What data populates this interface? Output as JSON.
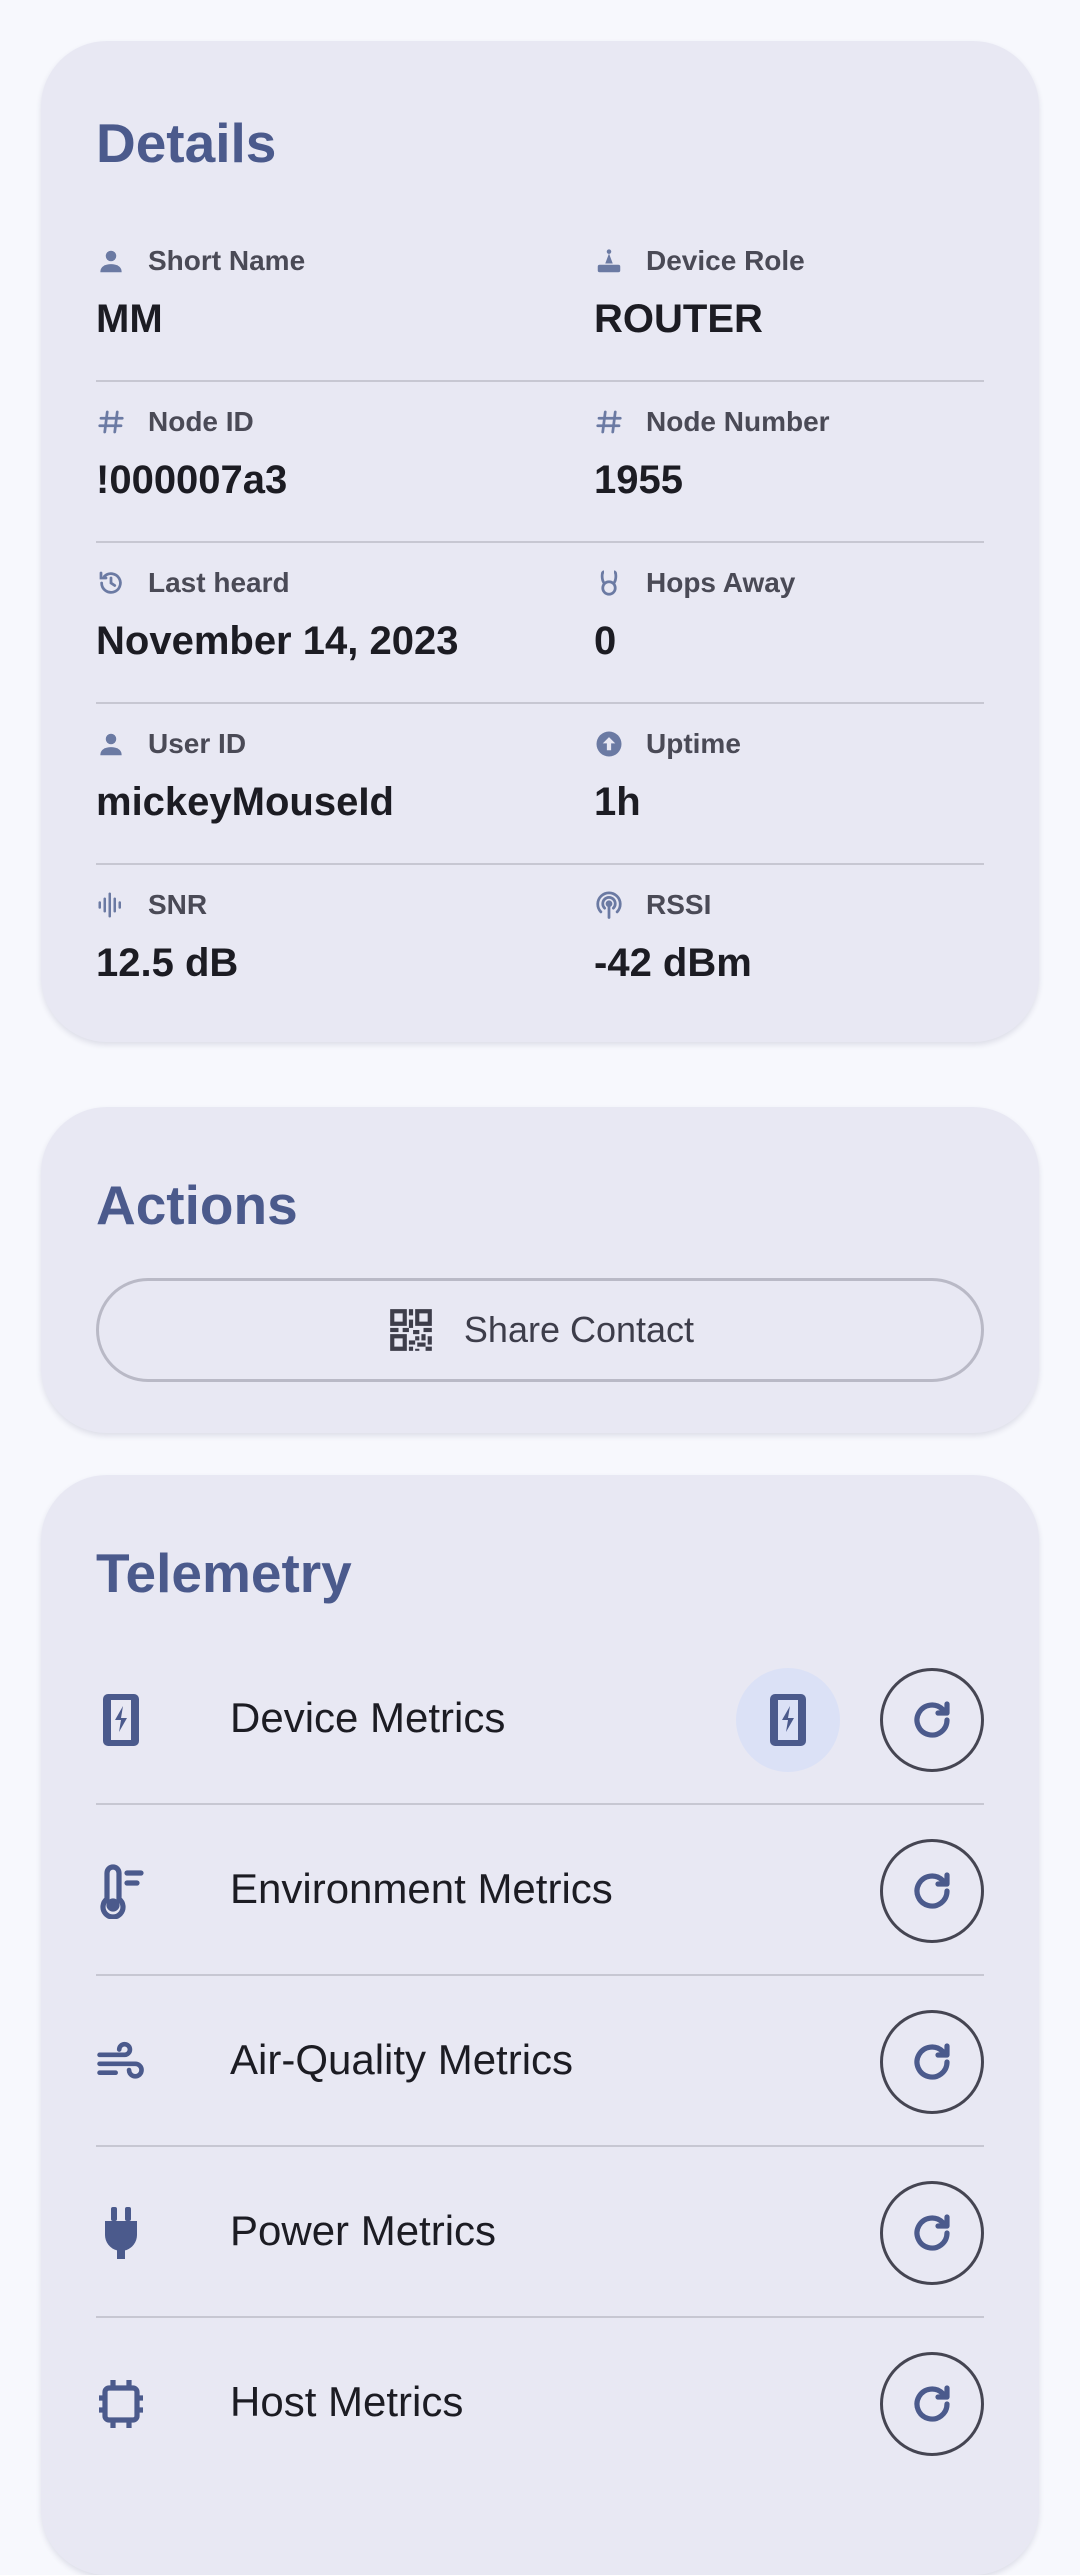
{
  "details": {
    "title": "Details",
    "fields": [
      {
        "label": "Short Name",
        "value": "MM"
      },
      {
        "label": "Device Role",
        "value": "ROUTER"
      },
      {
        "label": "Node ID",
        "value": "!000007a3"
      },
      {
        "label": "Node Number",
        "value": "1955"
      },
      {
        "label": "Last heard",
        "value": "November 14, 2023"
      },
      {
        "label": "Hops Away",
        "value": "0"
      },
      {
        "label": "User ID",
        "value": "mickeyMouseId"
      },
      {
        "label": "Uptime",
        "value": "1h"
      },
      {
        "label": "SNR",
        "value": "12.5 dB"
      },
      {
        "label": "RSSI",
        "value": "-42 dBm"
      }
    ]
  },
  "actions": {
    "title": "Actions",
    "share_contact_label": "Share Contact"
  },
  "telemetry": {
    "title": "Telemetry",
    "items": [
      {
        "label": "Device Metrics",
        "icon": "device-metrics-icon"
      },
      {
        "label": "Environment Metrics",
        "icon": "thermometer-icon"
      },
      {
        "label": "Air-Quality Metrics",
        "icon": "air-icon"
      },
      {
        "label": "Power Metrics",
        "icon": "plug-icon"
      },
      {
        "label": "Host Metrics",
        "icon": "host-icon"
      }
    ]
  },
  "colors": {
    "accent": "#4b5a8c",
    "card_bg": "#e8e8f3",
    "page_bg": "#f7f8fd"
  }
}
